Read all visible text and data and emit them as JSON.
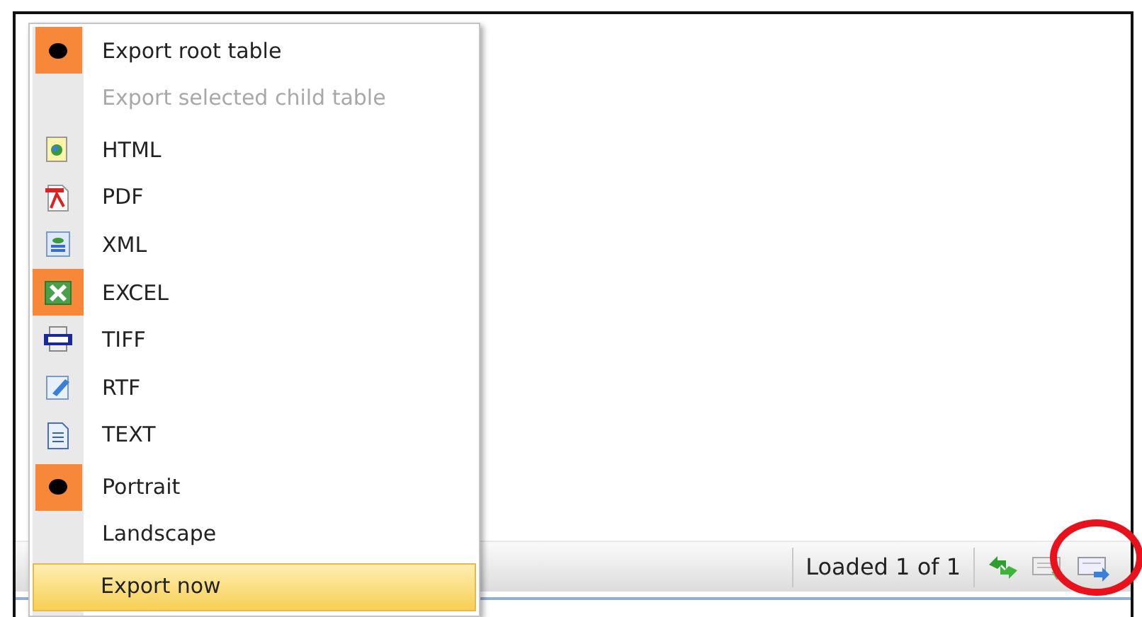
{
  "menu": {
    "items": [
      {
        "kind": "radio",
        "label": "Export root table",
        "selected": true,
        "disabled": false
      },
      {
        "kind": "radio",
        "label": "Export selected child table",
        "selected": false,
        "disabled": true
      },
      {
        "kind": "separator"
      },
      {
        "kind": "format",
        "label": "HTML",
        "selected": false
      },
      {
        "kind": "format",
        "label": "PDF",
        "selected": false
      },
      {
        "kind": "format",
        "label": "XML",
        "selected": false
      },
      {
        "kind": "format",
        "label": "EXCEL",
        "selected": true
      },
      {
        "kind": "format",
        "label": "TIFF",
        "selected": false
      },
      {
        "kind": "format",
        "label": "RTF",
        "selected": false
      },
      {
        "kind": "format",
        "label": "TEXT",
        "selected": false
      },
      {
        "kind": "separator"
      },
      {
        "kind": "radio",
        "label": "Portrait",
        "selected": true,
        "disabled": false
      },
      {
        "kind": "radio",
        "label": "Landscape",
        "selected": false,
        "disabled": false
      },
      {
        "kind": "action",
        "label": "Export now",
        "highlighted": true
      }
    ]
  },
  "status_bar": {
    "text": "Loaded 1 of 1"
  }
}
